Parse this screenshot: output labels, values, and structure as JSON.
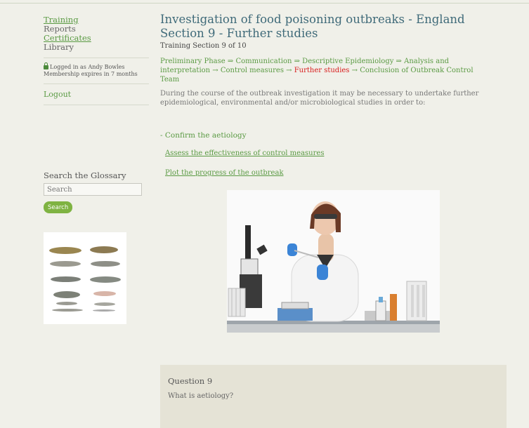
{
  "sidebar": {
    "nav": [
      "Training",
      "Reports",
      "Certificates",
      "Library"
    ],
    "login_prefix": "Logged in as ",
    "login_user": "Andy Bowles",
    "membership": "Membership expires in 7 months",
    "logout": "Logout",
    "search_title": "Search the Glossary",
    "search_placeholder": "Search",
    "search_button": "Search"
  },
  "main": {
    "title": "Investigation of food poisoning outbreaks - England Section 9 - Further studies",
    "subtitle": "Training Section 9 of 10",
    "breadcrumb": {
      "s1": "Preliminary Phase",
      "s2": "Communication",
      "s3": "Descriptive Epidemiology",
      "s4": "Analysis and interpretation",
      "s5": "Control measures",
      "s6": "Further studies",
      "s7": "Conclusion of Outbreak Control Team",
      "arrow": " ⇒ ",
      "arrow2": " → "
    },
    "intro": "During the course of the outbreak investigation it may be necessary to undertake further epidemiological, environmental and/or microbiological studies in order to:",
    "bullets": [
      "- Confirm the aetiology",
      "Assess the effectiveness of control measures",
      "Plot the progress of the outbreak"
    ],
    "question": {
      "title": "Question 9",
      "text": "What is aetiology?"
    }
  },
  "colors": {
    "link": "#5a9a43",
    "title": "#3f6a79",
    "current": "#d81b1b",
    "button": "#7fb342"
  }
}
